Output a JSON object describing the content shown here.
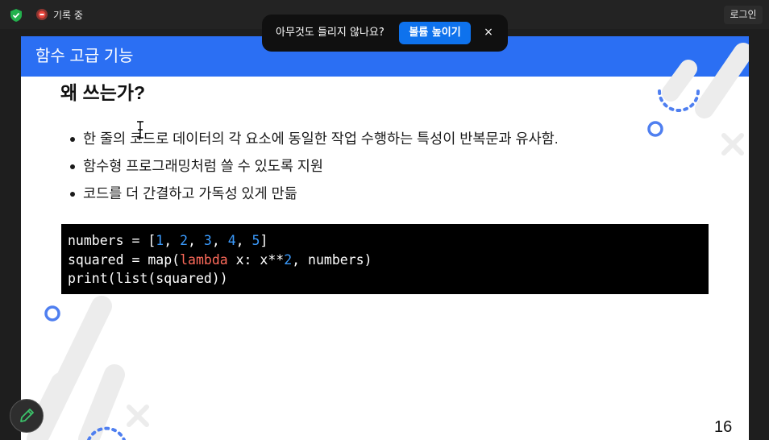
{
  "topbar": {
    "recording_label": "기록 중",
    "login_label": "로그인"
  },
  "audio_notice": {
    "message": "아무것도 들리지 않나요?",
    "button_label": "볼륨 높이기",
    "close_label": "×"
  },
  "slide": {
    "header_title": "함수 고급 기능",
    "section_heading": "왜 쓰는가?",
    "bullets": [
      "한 줄의 코드로 데이터의 각 요소에 동일한 작업 수행하는 특성이 반복문과 유사함.",
      "함수형 프로그래밍처럼 쓸 수 있도록 지원",
      "코드를 더 간결하고 가독성 있게 만듦"
    ],
    "code": {
      "line1": {
        "a": "numbers = [",
        "n1": "1",
        "c1": ", ",
        "n2": "2",
        "c2": ", ",
        "n3": "3",
        "c3": ", ",
        "n4": "4",
        "c4": ", ",
        "n5": "5",
        "end": "]"
      },
      "line2": {
        "a": "squared = map(",
        "kw": "lambda",
        "b": " x: x**",
        "n": "2",
        "c": ", numbers)"
      },
      "line3": "print(list(squared))"
    },
    "page_number": "16"
  },
  "colors": {
    "header_blue": "#2b6ff3",
    "accent_button": "#0e72ed",
    "code_number": "#3b9cff",
    "code_keyword": "#ff6b5b",
    "shield_green": "#23b14d",
    "record_red": "#e8453c"
  },
  "icons": {
    "security": "shield-check-icon",
    "recording": "record-icon",
    "pen": "pen-icon",
    "cursor": "text-cursor-icon"
  }
}
